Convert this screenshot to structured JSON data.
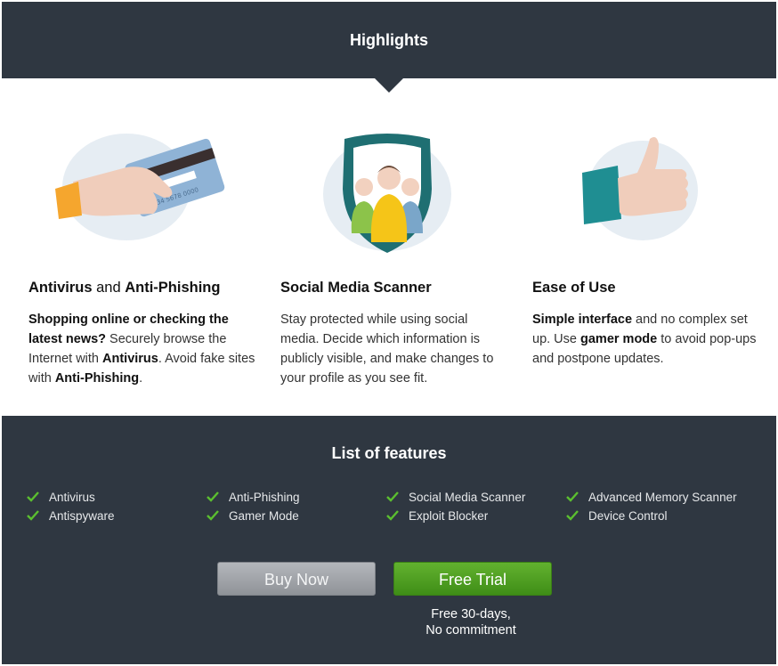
{
  "header": {
    "title": "Highlights"
  },
  "highlights": [
    {
      "title_part1": "Antivirus",
      "title_part2": " and ",
      "title_part3": "Anti-Phishing",
      "body": {
        "b1": "Shopping online or checking the latest news?",
        "t1": " Securely browse the Internet with ",
        "b2": "Antivirus",
        "t2": ". Avoid fake sites with ",
        "b3": "Anti-Phishing",
        "t3": "."
      },
      "card_number": "1234 5678 0000"
    },
    {
      "title": "Social Media Scanner",
      "body": "Stay protected while using social media. Decide which information is publicly visible, and make changes to your profile as you see fit."
    },
    {
      "title": "Ease of Use",
      "body": {
        "b1": "Simple interface",
        "t1": " and no complex set up. Use ",
        "b2": "gamer mode",
        "t2": " to avoid pop-ups and postpone updates."
      }
    }
  ],
  "features": {
    "title": "List of features",
    "items": [
      "Antivirus",
      "Anti-Phishing",
      "Social Media Scanner",
      "Advanced Memory Scanner",
      "Antispyware",
      "Gamer Mode",
      "Exploit Blocker",
      "Device Control"
    ],
    "buy_label": "Buy Now",
    "trial_label": "Free Trial",
    "trial_note_line1": "Free 30-days,",
    "trial_note_line2": "No commitment"
  },
  "colors": {
    "dark_band": "#2f3741",
    "check_green": "#5bbf2f",
    "trial_green": "#4f9f22",
    "buy_gray": "#9fa3a8",
    "illustration_bg": "#e6edf3"
  }
}
